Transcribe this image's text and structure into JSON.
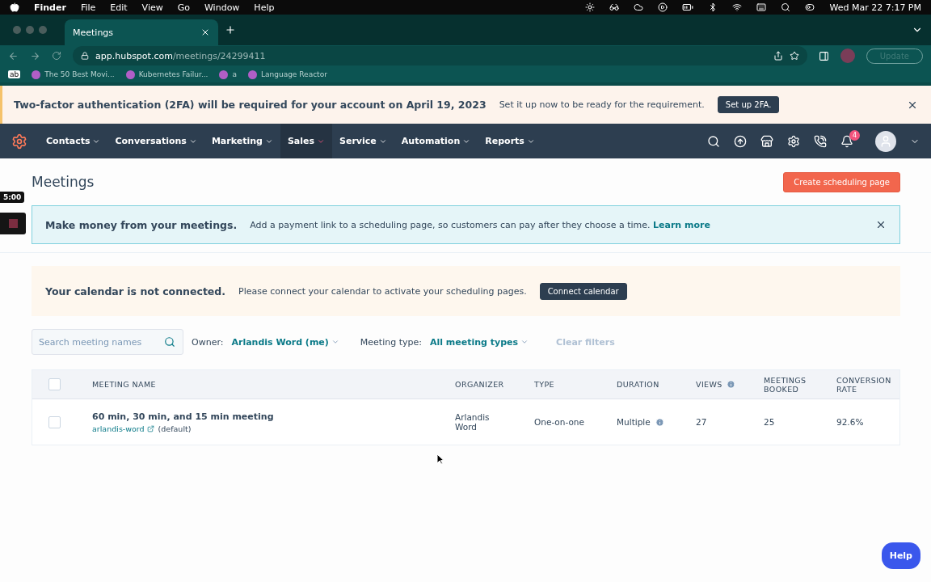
{
  "menubar": {
    "app": "Finder",
    "items": [
      "File",
      "Edit",
      "View",
      "Go",
      "Window",
      "Help"
    ],
    "clock": "Wed Mar 22  7:17 PM"
  },
  "browser": {
    "tab": {
      "title": "Meetings"
    },
    "url": {
      "host": "app.hubspot.com",
      "path": "/meetings/24299411"
    },
    "update_button": "Update",
    "bookmarks": [
      {
        "label": "ab",
        "kind": "logo"
      },
      {
        "label": "The 50 Best Movi...",
        "kind": "link"
      },
      {
        "label": "Kubernetes Failur...",
        "kind": "link"
      },
      {
        "label": "a",
        "kind": "link"
      },
      {
        "label": "Language Reactor",
        "kind": "link"
      }
    ]
  },
  "banner": {
    "title": "Two-factor authentication (2FA) will be required for your account on April 19, 2023",
    "text": "Set it up now to be ready for the requirement.",
    "button": "Set up 2FA."
  },
  "nav": {
    "items": [
      {
        "label": "Contacts",
        "selected": false
      },
      {
        "label": "Conversations",
        "selected": false
      },
      {
        "label": "Marketing",
        "selected": false
      },
      {
        "label": "Sales",
        "selected": true
      },
      {
        "label": "Service",
        "selected": false
      },
      {
        "label": "Automation",
        "selected": false
      },
      {
        "label": "Reports",
        "selected": false
      }
    ],
    "notifications": "4"
  },
  "page": {
    "title": "Meetings",
    "create_button": "Create scheduling page",
    "promo": {
      "title": "Make money from your meetings.",
      "text": "Add a payment link to a scheduling page, so customers can pay after they choose a time.",
      "link": "Learn more"
    },
    "calendar": {
      "title": "Your calendar is not connected.",
      "text": "Please connect your calendar to activate your scheduling pages.",
      "button": "Connect calendar"
    },
    "filters": {
      "search_placeholder": "Search meeting names",
      "owner_label": "Owner:",
      "owner_value": "Arlandis Word (me)",
      "type_label": "Meeting type:",
      "type_value": "All meeting types",
      "clear": "Clear filters"
    },
    "table": {
      "select_all": {
        "checked": false
      },
      "columns": [
        {
          "label": "MEETING NAME",
          "info": false
        },
        {
          "label": "ORGANIZER",
          "info": false
        },
        {
          "label": "TYPE",
          "info": false
        },
        {
          "label": "DURATION",
          "info": false
        },
        {
          "label": "VIEWS",
          "info": true
        },
        {
          "label": "MEETINGS BOOKED",
          "info": false
        },
        {
          "label": "CONVERSION RATE",
          "info": false
        }
      ],
      "rows": [
        {
          "checked": false,
          "name": "60 min, 30 min, and 15 min meeting",
          "slug": "arlandis-word",
          "tag": "(default)",
          "organizer": "Arlandis Word",
          "type": "One-on-one",
          "duration": "Multiple",
          "duration_info": true,
          "views": "27",
          "booked": "25",
          "conversion": "92.6%"
        }
      ]
    }
  },
  "overlay": {
    "timer": "5:00"
  },
  "help_button": "Help"
}
